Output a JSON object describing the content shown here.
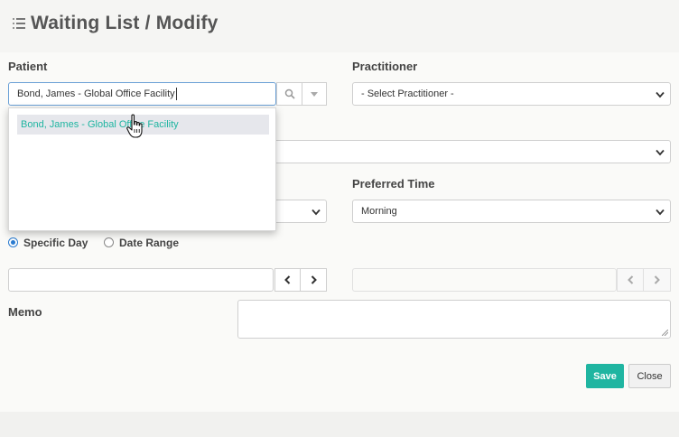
{
  "header": {
    "title": "Waiting List / Modify",
    "icon": "list-icon"
  },
  "patient": {
    "label": "Patient",
    "value": "Bond, James - Global Office Facility",
    "search_icon": "search-icon",
    "dropdown_icon": "caret-down-icon",
    "suggestions": [
      "Bond, James - Global Office Facility"
    ]
  },
  "practitioner": {
    "label": "Practitioner",
    "selected": "- Select Practitioner -"
  },
  "row2": {
    "selected": ""
  },
  "row3": {
    "left_selected": "",
    "preferred_time_label": "Preferred Time",
    "preferred_time_selected": "Morning"
  },
  "date_mode": {
    "specific_day_label": "Specific Day",
    "date_range_label": "Date Range",
    "selected": "Specific Day"
  },
  "memo": {
    "label": "Memo",
    "value": ""
  },
  "actions": {
    "save_label": "Save",
    "close_label": "Close"
  },
  "colors": {
    "accent": "#1fb5a1",
    "focus": "#6aa0d6",
    "radio": "#2a7bd0"
  }
}
